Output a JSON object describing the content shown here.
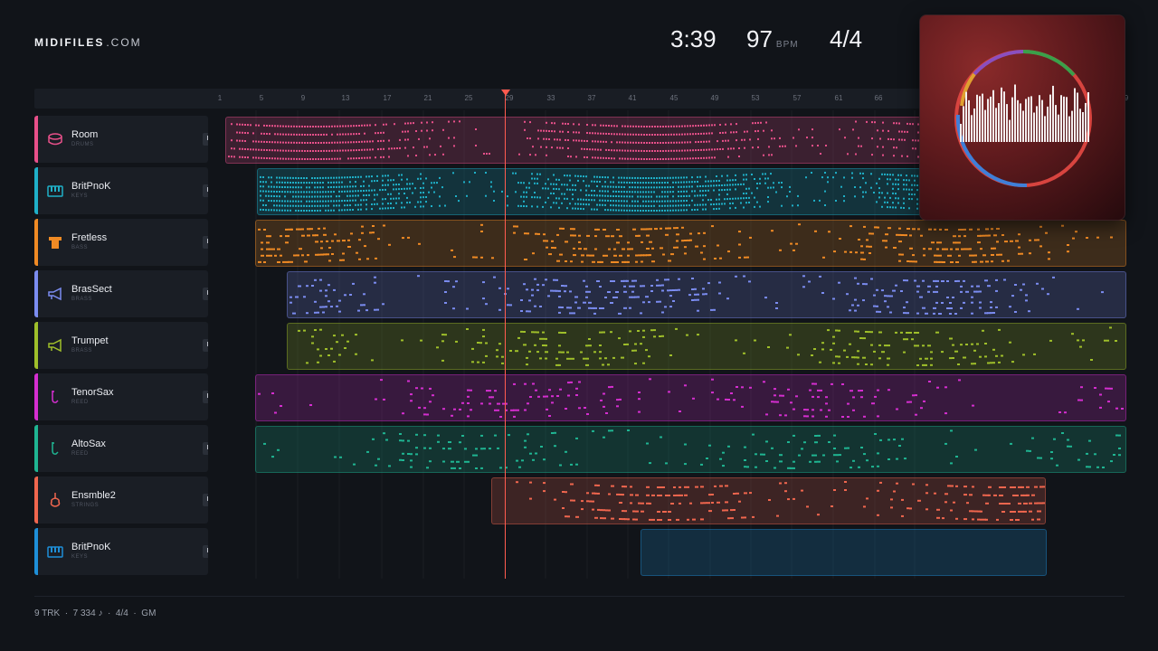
{
  "brand": {
    "bold": "MIDIFILES",
    "light": ".COM"
  },
  "stats": {
    "time": "3:39",
    "bpm": "97",
    "bpm_unit": "BPM",
    "signature": "4/4"
  },
  "ruler": [
    "1",
    "5",
    "9",
    "13",
    "17",
    "21",
    "25",
    "29",
    "33",
    "37",
    "41",
    "45",
    "49",
    "53",
    "57",
    "61",
    "66",
    "9"
  ],
  "tracks": [
    {
      "name": "Room",
      "type": "DRUMS",
      "color": "#e8508a",
      "icon": "drum-icon"
    },
    {
      "name": "BritPnoK",
      "type": "KEYS",
      "color": "#1fb0c8",
      "icon": "piano-icon"
    },
    {
      "name": "Fretless",
      "type": "BASS",
      "color": "#f08a24",
      "icon": "bass-amp-icon"
    },
    {
      "name": "BrasSect",
      "type": "BRASS",
      "color": "#7b8cf0",
      "icon": "horn-icon"
    },
    {
      "name": "Trumpet",
      "type": "BRASS",
      "color": "#9fbf2a",
      "icon": "horn-icon"
    },
    {
      "name": "TenorSax",
      "type": "REED",
      "color": "#d52ed0",
      "icon": "sax-icon"
    },
    {
      "name": "AltoSax",
      "type": "REED",
      "color": "#1fb592",
      "icon": "sax-icon"
    },
    {
      "name": "Ensmble2",
      "type": "STRINGS",
      "color": "#f0664e",
      "icon": "violin-icon"
    },
    {
      "name": "BritPnoK",
      "type": "KEYS",
      "color": "#1e8fd8",
      "icon": "piano-icon"
    }
  ],
  "buttons": {
    "mute": "M",
    "solo": "S"
  },
  "footer": {
    "tracks": "9 TRK",
    "notes": "7 334 ♪",
    "signature": "4/4",
    "standard": "GM",
    "sep": "·"
  }
}
